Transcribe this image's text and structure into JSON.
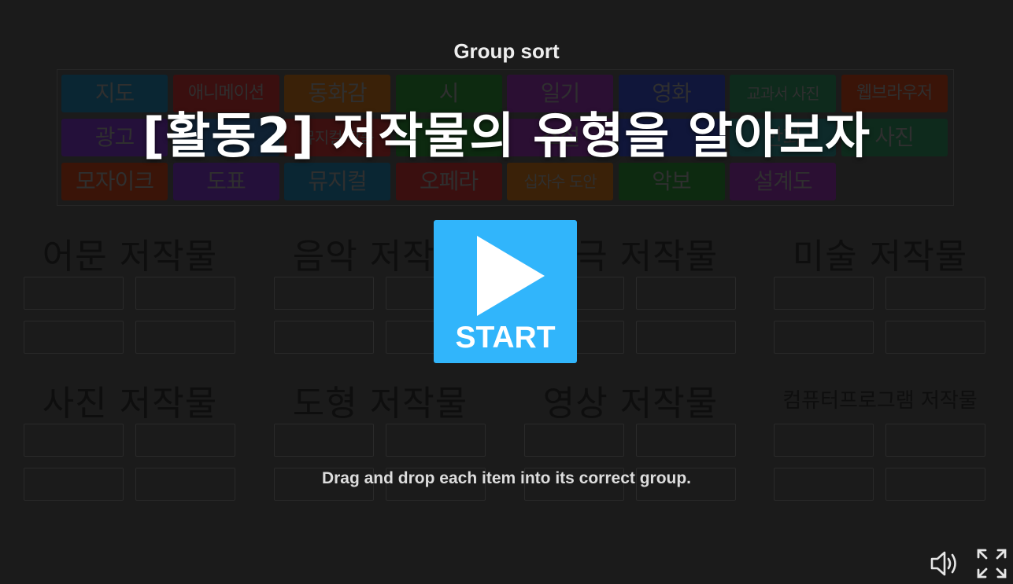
{
  "mode_label": "Group sort",
  "title": "[활동2] 저작물의 유형을 알아보자",
  "start_label": "START",
  "instructions": "Drag and drop each item into its correct group.",
  "tiles": [
    {
      "label": "지도",
      "color": "#0a2633"
    },
    {
      "label": "애니메이션",
      "color": "#3a0f0f"
    },
    {
      "label": "동화감",
      "color": "#3a2108"
    },
    {
      "label": "시",
      "color": "#0d2a10"
    },
    {
      "label": "일기",
      "color": "#2b0f33"
    },
    {
      "label": "영화",
      "color": "#10163a"
    },
    {
      "label": "교과서 사진",
      "color": "#0e2a1c"
    },
    {
      "label": "웹브라우저",
      "color": "#3a1408"
    },
    {
      "label": "광고",
      "color": "#24103a"
    },
    {
      "label": "",
      "color": "#0f2133"
    },
    {
      "label": "뮤지컬 작품",
      "color": "#3a0f0f"
    },
    {
      "label": "",
      "color": "#0d2a10"
    },
    {
      "label": "소설",
      "color": "#2b0f33"
    },
    {
      "label": "",
      "color": "#10163a"
    },
    {
      "label": "만화",
      "color": "#0e2a2a"
    },
    {
      "label": "사진",
      "color": "#0e2a1c"
    },
    {
      "label": "모자이크",
      "color": "#3a1408"
    },
    {
      "label": "도표",
      "color": "#24103a"
    },
    {
      "label": "뮤지컬",
      "color": "#0a2633"
    },
    {
      "label": "오페라",
      "color": "#3a0f0f"
    },
    {
      "label": "십자수 도안",
      "color": "#3a2108"
    },
    {
      "label": "악보",
      "color": "#0d2a10"
    },
    {
      "label": "설계도",
      "color": "#2b0f33"
    }
  ],
  "categories": [
    {
      "label": "어문 저작물"
    },
    {
      "label": "음악 저작물"
    },
    {
      "label": "연극 저작물"
    },
    {
      "label": "미술 저작물"
    },
    {
      "label": "사진 저작물"
    },
    {
      "label": "도형 저작물"
    },
    {
      "label": "영상 저작물"
    },
    {
      "label": "컴퓨터프로그램 저작물"
    }
  ],
  "controls": {
    "sound_icon": "speaker-icon",
    "fullscreen_icon": "fullscreen-icon"
  },
  "colors": {
    "start_button": "#31b5fb",
    "background": "#1b1b1b"
  }
}
